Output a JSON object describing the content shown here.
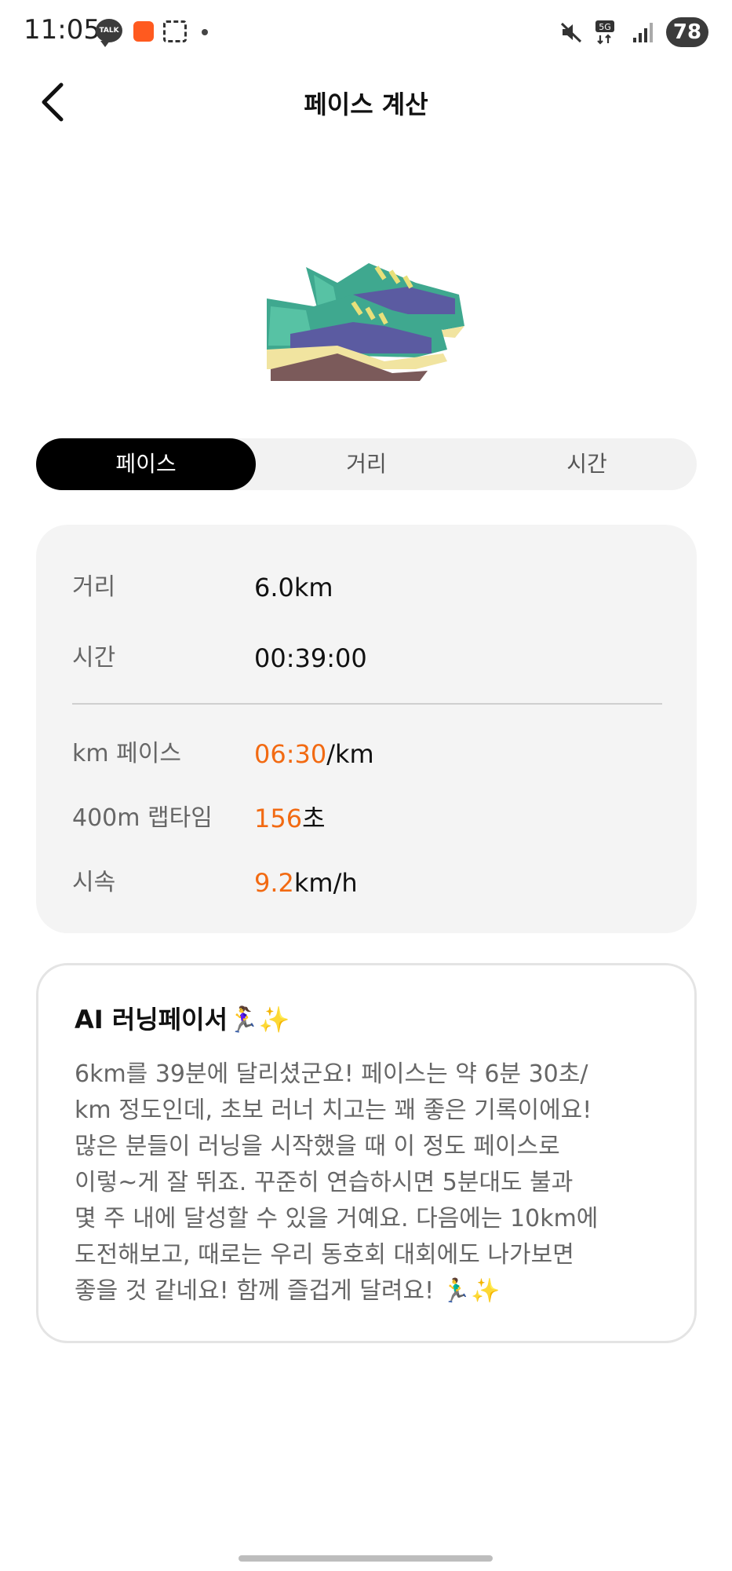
{
  "status_bar": {
    "time": "11:05",
    "talk_label": "TALK",
    "network": "5G",
    "battery": "78"
  },
  "header": {
    "title": "페이스 계산",
    "back_icon": "chevron-left-icon"
  },
  "tabs": [
    {
      "label": "페이스",
      "active": true
    },
    {
      "label": "거리",
      "active": false
    },
    {
      "label": "시간",
      "active": false
    }
  ],
  "inputs": {
    "distance_label": "거리",
    "distance_value": "6.0km",
    "time_label": "시간",
    "time_value": "00:39:00"
  },
  "results": {
    "pace_label": "km 페이스",
    "pace_value": "06:30",
    "pace_unit": "/km",
    "lap_label": "400m 랩타임",
    "lap_value": "156",
    "lap_unit": "초",
    "speed_label": "시속",
    "speed_value": "9.2",
    "speed_unit": "km/h"
  },
  "ai": {
    "title": "AI 러닝페이서🏃‍♀️✨",
    "body": "6km를 39분에 달리셨군요! 페이스는 약 6분 30초/\nkm 정도인데, 초보 러너 치고는 꽤 좋은 기록이에요!\n많은 분들이 러닝을 시작했을 때 이 정도 페이스로\n이렇~게 잘 뛰죠. 꾸준히 연습하시면 5분대도 불과\n몇 주 내에 달성할 수 있을 거예요. 다음에는 10km에\n도전해보고, 때로는 우리 동호회 대회에도 나가보면\n좋을 것 같네요! 함께 즐겁게 달려요! 🏃‍♂️✨"
  },
  "colors": {
    "accent": "#f26a12",
    "active_tab": "#000000",
    "card_bg": "#f4f4f4"
  }
}
